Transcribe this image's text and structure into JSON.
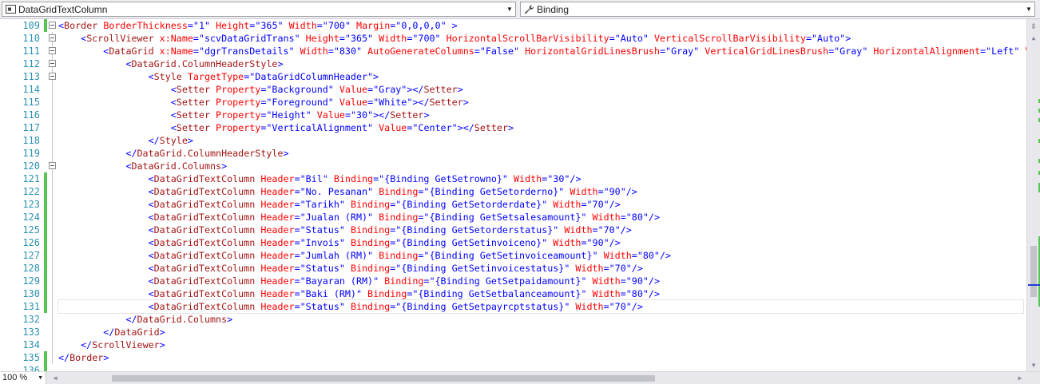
{
  "navigation": {
    "type_selector": "DataGridTextColumn",
    "member_selector": "Binding"
  },
  "editor": {
    "lines": [
      {
        "n": "109",
        "segs": [
          [
            "b",
            "<"
          ],
          [
            "t",
            "Border"
          ],
          [
            "a",
            " BorderThickness"
          ],
          [
            "b",
            "=\"1\""
          ],
          [
            "a",
            " Height"
          ],
          [
            "b",
            "=\"365\""
          ],
          [
            "a",
            " Width"
          ],
          [
            "b",
            "=\"700\""
          ],
          [
            "a",
            " Margin"
          ],
          [
            "b",
            "=\"0,0,0,0\""
          ],
          [
            "b",
            " >"
          ]
        ]
      },
      {
        "n": "110",
        "segs": [
          [
            "b",
            "    <"
          ],
          [
            "t",
            "ScrollViewer"
          ],
          [
            "a",
            " x:Name"
          ],
          [
            "b",
            "=\"scvDataGridTrans\""
          ],
          [
            "a",
            " Height"
          ],
          [
            "b",
            "=\"365\""
          ],
          [
            "a",
            " Width"
          ],
          [
            "b",
            "=\"700\""
          ],
          [
            "a",
            " HorizontalScrollBarVisibility"
          ],
          [
            "b",
            "=\"Auto\""
          ],
          [
            "a",
            " VerticalScrollBarVisibility"
          ],
          [
            "b",
            "=\"Auto\">"
          ]
        ]
      },
      {
        "n": "111",
        "segs": [
          [
            "b",
            "        <"
          ],
          [
            "t",
            "DataGrid"
          ],
          [
            "a",
            " x:Name"
          ],
          [
            "b",
            "=\"dgrTransDetails\""
          ],
          [
            "a",
            " Width"
          ],
          [
            "b",
            "=\"830\""
          ],
          [
            "a",
            " AutoGenerateColumns"
          ],
          [
            "b",
            "=\"False\""
          ],
          [
            "a",
            " HorizontalGridLinesBrush"
          ],
          [
            "b",
            "=\"Gray\""
          ],
          [
            "a",
            " VerticalGridLinesBrush"
          ],
          [
            "b",
            "=\"Gray\""
          ],
          [
            "a",
            " HorizontalAlignment"
          ],
          [
            "b",
            "=\"Left\""
          ],
          [
            "a",
            " V"
          ]
        ]
      },
      {
        "n": "112",
        "segs": [
          [
            "b",
            "            <"
          ],
          [
            "t",
            "DataGrid.ColumnHeaderStyle"
          ],
          [
            "b",
            ">"
          ]
        ]
      },
      {
        "n": "113",
        "segs": [
          [
            "b",
            "                <"
          ],
          [
            "t",
            "Style"
          ],
          [
            "a",
            " TargetType"
          ],
          [
            "b",
            "=\"DataGridColumnHeader\">"
          ]
        ]
      },
      {
        "n": "114",
        "segs": [
          [
            "b",
            "                    <"
          ],
          [
            "t",
            "Setter"
          ],
          [
            "a",
            " Property"
          ],
          [
            "b",
            "=\"Background\""
          ],
          [
            "a",
            " Value"
          ],
          [
            "b",
            "=\"Gray\"></"
          ],
          [
            "t",
            "Setter"
          ],
          [
            "b",
            ">"
          ]
        ]
      },
      {
        "n": "115",
        "segs": [
          [
            "b",
            "                    <"
          ],
          [
            "t",
            "Setter"
          ],
          [
            "a",
            " Property"
          ],
          [
            "b",
            "=\"Foreground\""
          ],
          [
            "a",
            " Value"
          ],
          [
            "b",
            "=\"White\"></"
          ],
          [
            "t",
            "Setter"
          ],
          [
            "b",
            ">"
          ]
        ]
      },
      {
        "n": "116",
        "segs": [
          [
            "b",
            "                    <"
          ],
          [
            "t",
            "Setter"
          ],
          [
            "a",
            " Property"
          ],
          [
            "b",
            "=\"Height\""
          ],
          [
            "a",
            " Value"
          ],
          [
            "b",
            "=\"30\"></"
          ],
          [
            "t",
            "Setter"
          ],
          [
            "b",
            ">"
          ]
        ]
      },
      {
        "n": "117",
        "segs": [
          [
            "b",
            "                    <"
          ],
          [
            "t",
            "Setter"
          ],
          [
            "a",
            " Property"
          ],
          [
            "b",
            "=\"VerticalAlignment\""
          ],
          [
            "a",
            " Value"
          ],
          [
            "b",
            "=\"Center\"></"
          ],
          [
            "t",
            "Setter"
          ],
          [
            "b",
            ">"
          ]
        ]
      },
      {
        "n": "118",
        "segs": [
          [
            "b",
            "                </"
          ],
          [
            "t",
            "Style"
          ],
          [
            "b",
            ">"
          ]
        ]
      },
      {
        "n": "119",
        "segs": [
          [
            "b",
            "            </"
          ],
          [
            "t",
            "DataGrid.ColumnHeaderStyle"
          ],
          [
            "b",
            ">"
          ]
        ]
      },
      {
        "n": "120",
        "segs": [
          [
            "b",
            "            <"
          ],
          [
            "t",
            "DataGrid.Columns"
          ],
          [
            "b",
            ">"
          ]
        ]
      },
      {
        "n": "121",
        "segs": [
          [
            "b",
            "                <"
          ],
          [
            "t",
            "DataGridTextColumn"
          ],
          [
            "a",
            " Header"
          ],
          [
            "b",
            "=\"Bil\""
          ],
          [
            "a",
            " Binding"
          ],
          [
            "b",
            "=\"{Binding GetSetrowno}\""
          ],
          [
            "a",
            " Width"
          ],
          [
            "b",
            "=\"30\"/>"
          ]
        ]
      },
      {
        "n": "122",
        "segs": [
          [
            "b",
            "                <"
          ],
          [
            "t",
            "DataGridTextColumn"
          ],
          [
            "a",
            " Header"
          ],
          [
            "b",
            "=\"No. Pesanan\""
          ],
          [
            "a",
            " Binding"
          ],
          [
            "b",
            "=\"{Binding GetSetorderno}\""
          ],
          [
            "a",
            " Width"
          ],
          [
            "b",
            "=\"90\"/>"
          ]
        ]
      },
      {
        "n": "123",
        "segs": [
          [
            "b",
            "                <"
          ],
          [
            "t",
            "DataGridTextColumn"
          ],
          [
            "a",
            " Header"
          ],
          [
            "b",
            "=\"Tarikh\""
          ],
          [
            "a",
            " Binding"
          ],
          [
            "b",
            "=\"{Binding GetSetorderdate}\""
          ],
          [
            "a",
            " Width"
          ],
          [
            "b",
            "=\"70\"/>"
          ]
        ]
      },
      {
        "n": "124",
        "segs": [
          [
            "b",
            "                <"
          ],
          [
            "t",
            "DataGridTextColumn"
          ],
          [
            "a",
            " Header"
          ],
          [
            "b",
            "=\"Jualan (RM)\""
          ],
          [
            "a",
            " Binding"
          ],
          [
            "b",
            "=\"{Binding GetSetsalesamount}\""
          ],
          [
            "a",
            " Width"
          ],
          [
            "b",
            "=\"80\"/>"
          ]
        ]
      },
      {
        "n": "125",
        "segs": [
          [
            "b",
            "                <"
          ],
          [
            "t",
            "DataGridTextColumn"
          ],
          [
            "a",
            " Header"
          ],
          [
            "b",
            "=\"Status\""
          ],
          [
            "a",
            " Binding"
          ],
          [
            "b",
            "=\"{Binding GetSetorderstatus}\""
          ],
          [
            "a",
            " Width"
          ],
          [
            "b",
            "=\"70\"/>"
          ]
        ]
      },
      {
        "n": "126",
        "segs": [
          [
            "b",
            "                <"
          ],
          [
            "t",
            "DataGridTextColumn"
          ],
          [
            "a",
            " Header"
          ],
          [
            "b",
            "=\"Invois\""
          ],
          [
            "a",
            " Binding"
          ],
          [
            "b",
            "=\"{Binding GetSetinvoiceno}\""
          ],
          [
            "a",
            " Width"
          ],
          [
            "b",
            "=\"90\"/>"
          ]
        ]
      },
      {
        "n": "127",
        "segs": [
          [
            "b",
            "                <"
          ],
          [
            "t",
            "DataGridTextColumn"
          ],
          [
            "a",
            " Header"
          ],
          [
            "b",
            "=\"Jumlah (RM)\""
          ],
          [
            "a",
            " Binding"
          ],
          [
            "b",
            "=\"{Binding GetSetinvoiceamount}\""
          ],
          [
            "a",
            " Width"
          ],
          [
            "b",
            "=\"80\"/>"
          ]
        ]
      },
      {
        "n": "128",
        "segs": [
          [
            "b",
            "                <"
          ],
          [
            "t",
            "DataGridTextColumn"
          ],
          [
            "a",
            " Header"
          ],
          [
            "b",
            "=\"Status\""
          ],
          [
            "a",
            " Binding"
          ],
          [
            "b",
            "=\"{Binding GetSetinvoicestatus}\""
          ],
          [
            "a",
            " Width"
          ],
          [
            "b",
            "=\"70\"/>"
          ]
        ]
      },
      {
        "n": "129",
        "segs": [
          [
            "b",
            "                <"
          ],
          [
            "t",
            "DataGridTextColumn"
          ],
          [
            "a",
            " Header"
          ],
          [
            "b",
            "=\"Bayaran (RM)\""
          ],
          [
            "a",
            " Binding"
          ],
          [
            "b",
            "=\"{Binding GetSetpaidamount}\""
          ],
          [
            "a",
            " Width"
          ],
          [
            "b",
            "=\"90\"/>"
          ]
        ]
      },
      {
        "n": "130",
        "segs": [
          [
            "b",
            "                <"
          ],
          [
            "t",
            "DataGridTextColumn"
          ],
          [
            "a",
            " Header"
          ],
          [
            "b",
            "=\"Baki (RM)\""
          ],
          [
            "a",
            " Binding"
          ],
          [
            "b",
            "=\"{Binding GetSetbalanceamount}\""
          ],
          [
            "a",
            " Width"
          ],
          [
            "b",
            "=\"80\"/>"
          ]
        ]
      },
      {
        "n": "131",
        "segs": [
          [
            "b",
            "                <"
          ],
          [
            "t",
            "DataGridTextColumn"
          ],
          [
            "a",
            " Header"
          ],
          [
            "b",
            "=\"Status\""
          ],
          [
            "a",
            " Binding"
          ],
          [
            "b",
            "=\"{Binding GetSetpayrcptstatus}\""
          ],
          [
            "a",
            " Width"
          ],
          [
            "b",
            "=\"70\"/>"
          ]
        ]
      },
      {
        "n": "132",
        "segs": [
          [
            "b",
            "            </"
          ],
          [
            "t",
            "DataGrid.Columns"
          ],
          [
            "b",
            ">"
          ]
        ]
      },
      {
        "n": "133",
        "segs": [
          [
            "b",
            "        </"
          ],
          [
            "t",
            "DataGrid"
          ],
          [
            "b",
            ">"
          ]
        ]
      },
      {
        "n": "134",
        "segs": [
          [
            "b",
            "    </"
          ],
          [
            "t",
            "ScrollViewer"
          ],
          [
            "b",
            ">"
          ]
        ]
      },
      {
        "n": "135",
        "segs": [
          [
            "b",
            "</"
          ],
          [
            "t",
            "Border"
          ],
          [
            "b",
            ">"
          ]
        ]
      },
      {
        "n": "136",
        "segs": []
      }
    ]
  },
  "status": {
    "zoom_level": "100 %"
  },
  "colors": {
    "markup_delimiter": "#0000ff",
    "element_name": "#a31515",
    "attribute_name": "#ff0000",
    "line_number": "#2b91af",
    "changed_saved": "#57c453"
  }
}
